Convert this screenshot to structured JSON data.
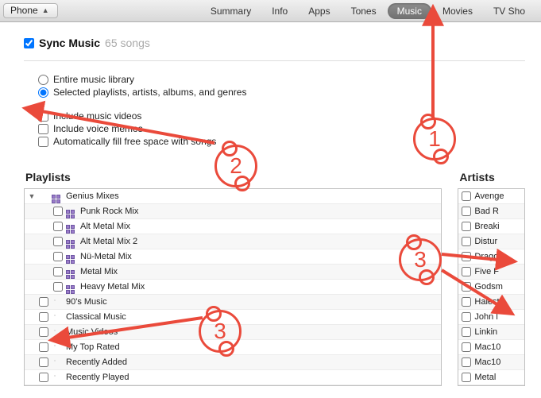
{
  "topbar": {
    "device_label": "Phone",
    "tabs": [
      "Summary",
      "Info",
      "Apps",
      "Tones",
      "Music",
      "Movies",
      "TV Sho"
    ],
    "selected_tab_index": 4
  },
  "sync": {
    "checkbox_checked": true,
    "title": "Sync Music",
    "count_text": "65 songs",
    "radio": {
      "entire": "Entire music library",
      "selected": "Selected playlists, artists, albums, and genres",
      "selected_index": 1
    },
    "options": {
      "videos": "Include music videos",
      "voice": "Include voice memos",
      "autofill": "Automatically fill free space with songs"
    }
  },
  "playlists": {
    "title": "Playlists",
    "rows": [
      {
        "label": "Genius Mixes",
        "icon": "genius",
        "indent": 0,
        "disclosure": true,
        "checkbox": false
      },
      {
        "label": "Punk Rock Mix",
        "icon": "genius",
        "indent": 1,
        "checkbox": true
      },
      {
        "label": "Alt Metal Mix",
        "icon": "genius",
        "indent": 1,
        "checkbox": true
      },
      {
        "label": "Alt Metal Mix 2",
        "icon": "genius",
        "indent": 1,
        "checkbox": true
      },
      {
        "label": "Nü-Metal Mix",
        "icon": "genius",
        "indent": 1,
        "checkbox": true
      },
      {
        "label": "Metal Mix",
        "icon": "genius",
        "indent": 1,
        "checkbox": true
      },
      {
        "label": "Heavy Metal Mix",
        "icon": "genius",
        "indent": 1,
        "checkbox": true
      },
      {
        "label": "90's Music",
        "icon": "gear",
        "indent": 0,
        "checkbox": true
      },
      {
        "label": "Classical Music",
        "icon": "gear",
        "indent": 0,
        "checkbox": true
      },
      {
        "label": "Music Videos",
        "icon": "gear",
        "indent": 0,
        "checkbox": true
      },
      {
        "label": "My Top Rated",
        "icon": "gear",
        "indent": 0,
        "checkbox": true
      },
      {
        "label": "Recently Added",
        "icon": "gear",
        "indent": 0,
        "checkbox": true
      },
      {
        "label": "Recently Played",
        "icon": "gear",
        "indent": 0,
        "checkbox": true
      }
    ]
  },
  "artists": {
    "title": "Artists",
    "rows": [
      "Avenge",
      "Bad R",
      "Breaki",
      "Distur",
      "Drago",
      "Five F",
      "Godsm",
      "Halest",
      "John l",
      "Linkin",
      "Mac10",
      "Mac10",
      "Metal"
    ]
  },
  "annotations": {
    "n1": "1",
    "n2": "2",
    "n3a": "3",
    "n3b": "3"
  }
}
